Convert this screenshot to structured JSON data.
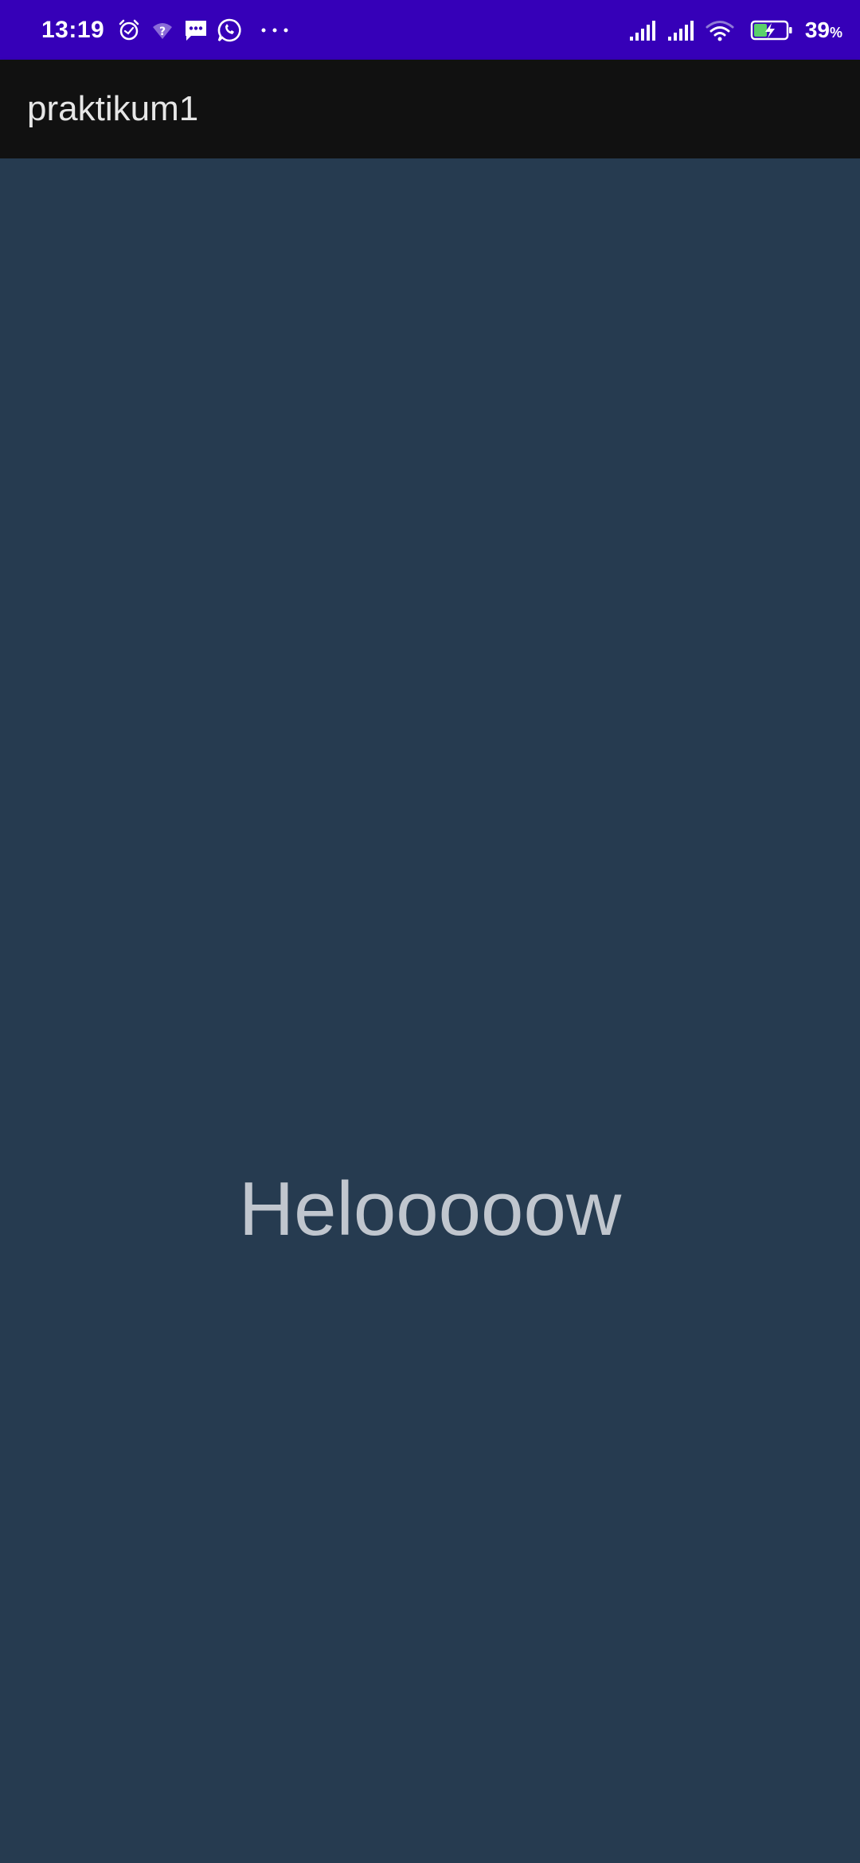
{
  "status_bar": {
    "time": "13:19",
    "battery_percent": "39",
    "battery_unit": "%",
    "icons": [
      "alarm-icon",
      "wifi-question-icon",
      "message-icon",
      "whatsapp-icon",
      "more-dots-icon",
      "signal-icon",
      "signal-icon",
      "wifi-icon",
      "battery-charging-icon"
    ],
    "background": "#3600b8"
  },
  "app_bar": {
    "title": "praktikum1",
    "background": "#111111"
  },
  "content": {
    "text": "Helooooow",
    "background": "#263b50",
    "text_color": "#c0c6ce"
  }
}
